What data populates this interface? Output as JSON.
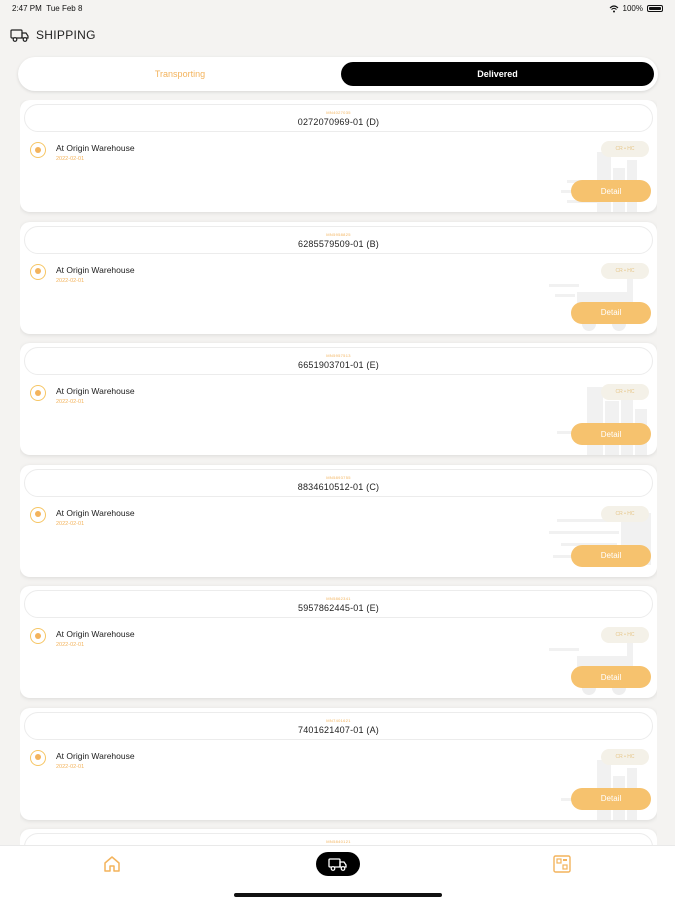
{
  "status_bar": {
    "time": "2:47 PM",
    "date": "Tue Feb 8",
    "battery": "100%"
  },
  "header": {
    "title": "SHIPPING",
    "icon": "truck-icon"
  },
  "segment": {
    "tab_transporting": "Transporting",
    "tab_delivered": "Delivered",
    "selected": "Delivered"
  },
  "cards": [
    {
      "code": "MN4027035",
      "number": "0272070969-01 (D)",
      "status": "At Origin Warehouse",
      "date": "2022-02-01",
      "tag": "CR • HC",
      "detail_label": "Detail"
    },
    {
      "code": "MN5958825",
      "number": "6285579509-01 (B)",
      "status": "At Origin Warehouse",
      "date": "2022-02-01",
      "tag": "CR • HC",
      "detail_label": "Detail"
    },
    {
      "code": "MN5957513",
      "number": "6651903701-01 (E)",
      "status": "At Origin Warehouse",
      "date": "2022-02-01",
      "tag": "CR • HC",
      "detail_label": "Detail"
    },
    {
      "code": "MN5893755",
      "number": "8834610512-01 (C)",
      "status": "At Origin Warehouse",
      "date": "2022-02-01",
      "tag": "CR • HC",
      "detail_label": "Detail"
    },
    {
      "code": "MN5862341",
      "number": "5957862445-01 (E)",
      "status": "At Origin Warehouse",
      "date": "2022-02-01",
      "tag": "CR • HC",
      "detail_label": "Detail"
    },
    {
      "code": "MN7401621",
      "number": "7401621407-01 (A)",
      "status": "At Origin Warehouse",
      "date": "2022-02-01",
      "tag": "CR • HC",
      "detail_label": "Detail"
    },
    {
      "code": "MN5840121",
      "number": "",
      "status": "",
      "date": "",
      "tag": "",
      "detail_label": ""
    }
  ],
  "tabbar": {
    "items": [
      "home-icon",
      "shipping-truck-icon",
      "scan-icon"
    ],
    "active": "shipping-truck-icon"
  },
  "colors": {
    "accent": "#f3b35c",
    "detail_button": "#f6c26e",
    "selected_tab": "#000000",
    "background": "#f4f3f1"
  }
}
